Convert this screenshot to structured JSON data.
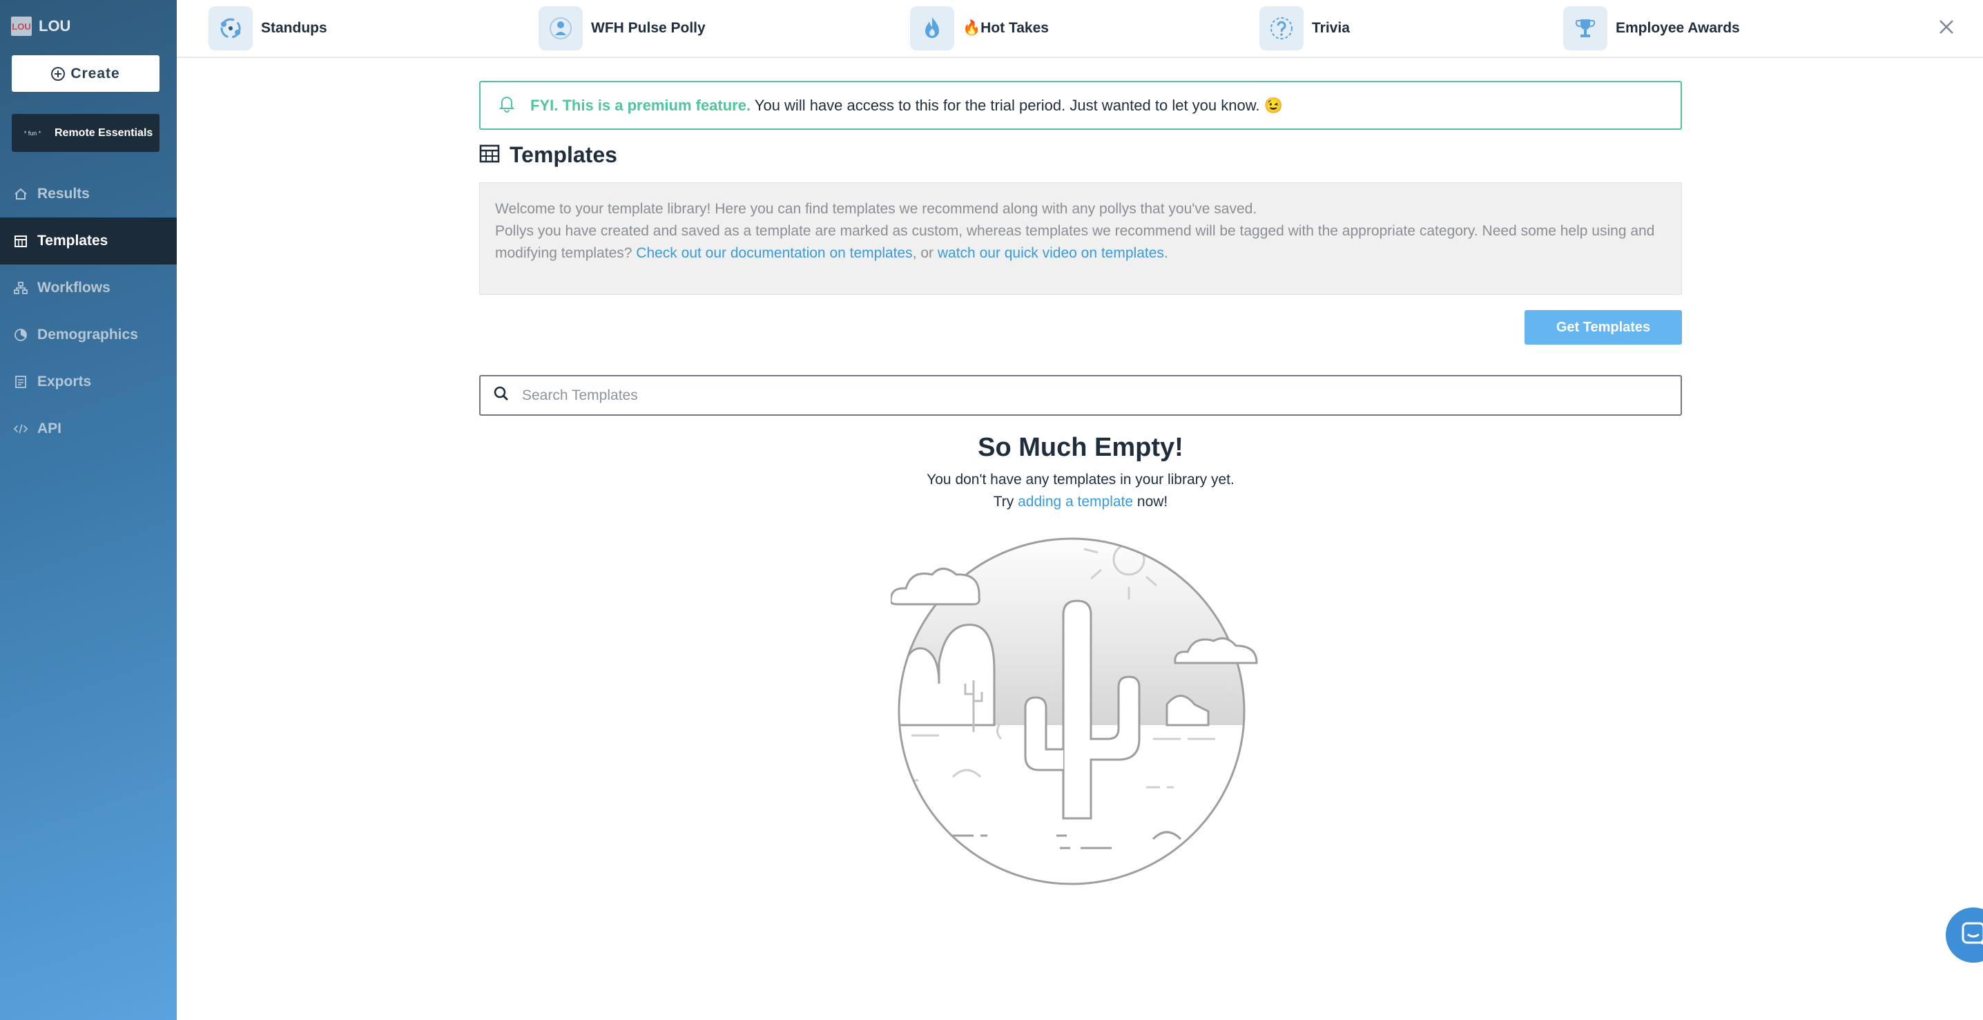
{
  "sidebar": {
    "org_logo": "LOU",
    "org_name": "LOU",
    "create_label": "Create",
    "remote_label": "Remote Essentials",
    "remote_logo": "* fun *",
    "items": [
      {
        "label": "Results",
        "icon": "home-icon"
      },
      {
        "label": "Templates",
        "icon": "calendar-icon",
        "active": true
      },
      {
        "label": "Workflows",
        "icon": "workflow-icon"
      },
      {
        "label": "Demographics",
        "icon": "demographics-icon"
      },
      {
        "label": "Exports",
        "icon": "document-icon"
      },
      {
        "label": "API",
        "icon": "code-icon"
      }
    ]
  },
  "topbar": {
    "items": [
      {
        "label": "Standups",
        "icon": "standups-icon"
      },
      {
        "label": "WFH Pulse Polly",
        "icon": "person-icon"
      },
      {
        "label": "🔥Hot Takes",
        "icon": "flame-icon"
      },
      {
        "label": "Trivia",
        "icon": "question-icon"
      },
      {
        "label": "Employee Awards",
        "icon": "trophy-icon"
      }
    ],
    "close_icon": "close-icon"
  },
  "banner": {
    "strong": "FYI. This is a premium feature.",
    "text": " You will have access to this for the trial period. Just wanted to let you know. 😉"
  },
  "page": {
    "title": "Templates"
  },
  "info": {
    "line1": "Welcome to your template library! Here you can find templates we recommend along with any pollys that you've saved.",
    "line2": "Pollys you have created and saved as a template are marked as custom, whereas templates we recommend will be tagged with the appropriate category. Need some help using and modifying templates? ",
    "link1": "Check out our documentation on templates",
    "sep": ", or ",
    "link2": "watch our quick video on templates",
    "end": "."
  },
  "actions": {
    "get_templates": "Get Templates"
  },
  "search": {
    "placeholder": "Search Templates",
    "value": ""
  },
  "empty": {
    "title": "So Much Empty!",
    "line1": "You don't have any templates in your library yet.",
    "try": "Try ",
    "link": "adding a template",
    "now": " now!"
  },
  "colors": {
    "accent": "#52c49d",
    "link": "#3a9ad9",
    "button": "#64b5f0",
    "sidebar_active": "#1b2b3a"
  }
}
